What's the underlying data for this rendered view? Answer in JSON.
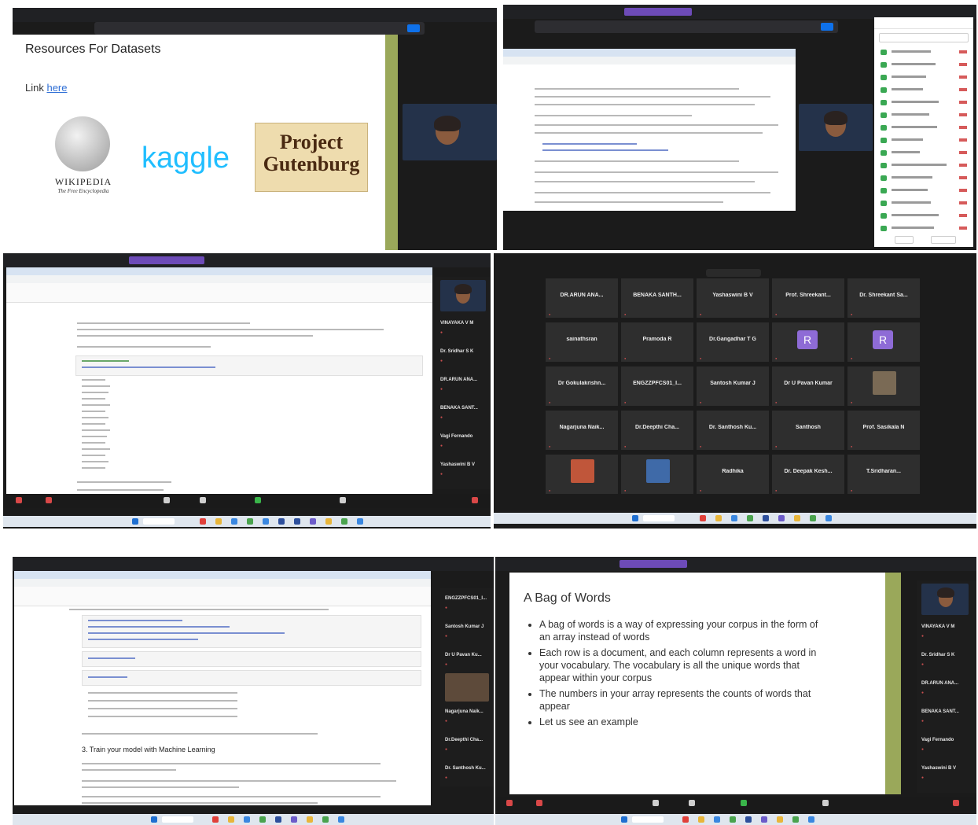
{
  "panel1": {
    "slide_title": "Resources For Datasets",
    "link_prefix": "Link ",
    "link_text": "here",
    "wikipedia_name": "WIKIPEDIA",
    "wikipedia_tagline": "The Free Encyclopedia",
    "kaggle": "kaggle",
    "gutenberg_line1": "Project",
    "gutenberg_line2": "Gutenburg"
  },
  "panel4": {
    "gallery": [
      {
        "name": "DR.ARUN ANA...",
        "type": "name"
      },
      {
        "name": "BENAKA SANTH...",
        "type": "name"
      },
      {
        "name": "Yashaswini B V",
        "type": "name"
      },
      {
        "name": "Prof. Shreekant...",
        "type": "name"
      },
      {
        "name": "Dr. Shreekant Sa...",
        "type": "name"
      },
      {
        "name": "sainathsran",
        "type": "name"
      },
      {
        "name": "Pramoda R",
        "type": "name"
      },
      {
        "name": "Dr.Gangadhar T G",
        "type": "name"
      },
      {
        "name": "R",
        "type": "avatar"
      },
      {
        "name": "R",
        "type": "avatar"
      },
      {
        "name": "Dr Gokulakrishn...",
        "type": "name"
      },
      {
        "name": "ENGZZPFCS01_I...",
        "type": "name"
      },
      {
        "name": "Santosh Kumar J",
        "type": "name"
      },
      {
        "name": "Dr U Pavan Kumar",
        "type": "name"
      },
      {
        "name": "",
        "type": "photo"
      },
      {
        "name": "Nagarjuna Naik...",
        "type": "name"
      },
      {
        "name": "Dr.Deepthi Cha...",
        "type": "name"
      },
      {
        "name": "Dr. Santhosh Ku...",
        "type": "name"
      },
      {
        "name": "Santhosh",
        "type": "name"
      },
      {
        "name": "Prof. Sasikala N",
        "type": "name"
      },
      {
        "name": "",
        "type": "photo"
      },
      {
        "name": "",
        "type": "photo"
      },
      {
        "name": "Radhika",
        "type": "name"
      },
      {
        "name": "Dr. Deepak Kesh...",
        "type": "name"
      },
      {
        "name": "T.Sridharan...",
        "type": "name"
      }
    ]
  },
  "panel3": {
    "sidebar": [
      {
        "name": "VINAYAKA V M"
      },
      {
        "name": "Dr. Sridhar S K"
      },
      {
        "name": "DR.ARUN ANA..."
      },
      {
        "name": "BENAKA SANT..."
      },
      {
        "name": "Vagi Fernando"
      },
      {
        "name": "Yashaswini B V"
      }
    ]
  },
  "panel5": {
    "section_heading": "3. Train your model with Machine Learning",
    "sidebar": [
      {
        "name": "ENGZZPFCS01_I..."
      },
      {
        "name": "Santosh Kumar J"
      },
      {
        "name": "Dr U Pavan Ku..."
      },
      {
        "name": ""
      },
      {
        "name": "Nagarjuna Naik..."
      },
      {
        "name": "Dr.Deepthi Cha..."
      },
      {
        "name": "Dr. Santhosh Ku..."
      }
    ]
  },
  "panel6": {
    "slide_title": "A Bag of Words",
    "bullets": [
      "A bag of words is a way of expressing your corpus in the form of an array instead of words",
      "Each row is a document, and each column represents a word in your vocabulary. The vocabulary is all the unique words that appear within your corpus",
      "The numbers in your array represents the counts of words that appear",
      "Let us see an example"
    ],
    "sidebar": [
      {
        "name": "VINAYAKA V M"
      },
      {
        "name": "Dr. Sridhar S K"
      },
      {
        "name": "DR.ARUN ANA..."
      },
      {
        "name": "BENAKA SANT..."
      },
      {
        "name": "Vagi Fernando"
      },
      {
        "name": "Yashaswini B V"
      }
    ]
  },
  "colors": {
    "dark": "#1b1b1b",
    "accent_green": "#9aa85a",
    "kaggle_blue": "#20beff",
    "zoom_blue": "#0e71eb",
    "name_red": "#c94f4f"
  }
}
